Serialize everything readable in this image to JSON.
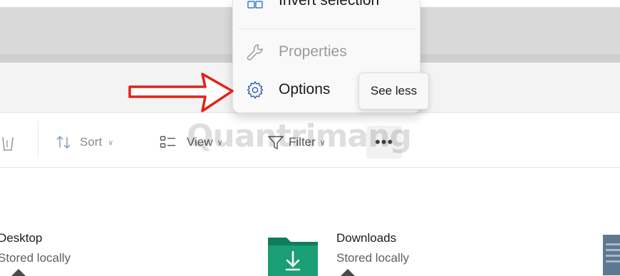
{
  "menu": {
    "items": [
      {
        "label": "Invert selection",
        "icon": "invert-selection-icon",
        "enabled": true
      },
      {
        "label": "Properties",
        "icon": "wrench-icon",
        "enabled": false
      },
      {
        "label": "Options",
        "icon": "gear-icon",
        "enabled": true
      }
    ]
  },
  "tooltip": {
    "label": "See less"
  },
  "toolbar": {
    "sort_label": "Sort",
    "view_label": "View",
    "filter_label": "Filter",
    "more_label": "•••"
  },
  "watermark": {
    "text": "Quantrimang"
  },
  "files": [
    {
      "name": "Desktop",
      "status": "Stored locally"
    },
    {
      "name": "Downloads",
      "status": "Stored locally"
    }
  ],
  "colors": {
    "arrow": "#e2231a",
    "folder_green": "#1a9e73",
    "folder_tab": "#0f7c5a"
  }
}
